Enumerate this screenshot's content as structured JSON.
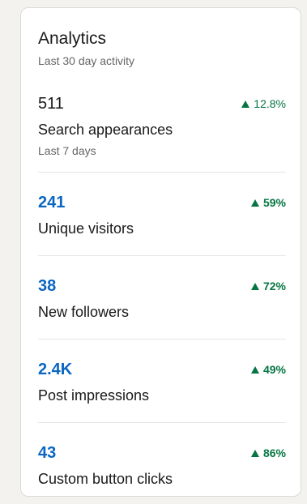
{
  "analytics": {
    "title": "Analytics",
    "subtitle": "Last 30 day activity",
    "accent_color": "#0a66c2",
    "positive_color": "#057642",
    "metrics": [
      {
        "value": "511",
        "label": "Search appearances",
        "period": "Last 7 days",
        "change": "12.8%",
        "trend_icon": "triangle-up-icon"
      },
      {
        "value": "241",
        "label": "Unique visitors",
        "change": "59%",
        "trend_icon": "triangle-up-icon"
      },
      {
        "value": "38",
        "label": "New followers",
        "change": "72%",
        "trend_icon": "triangle-up-icon"
      },
      {
        "value": "2.4K",
        "label": "Post impressions",
        "change": "49%",
        "trend_icon": "triangle-up-icon"
      },
      {
        "value": "43",
        "label": "Custom button clicks",
        "change": "86%",
        "trend_icon": "triangle-up-icon"
      }
    ]
  }
}
